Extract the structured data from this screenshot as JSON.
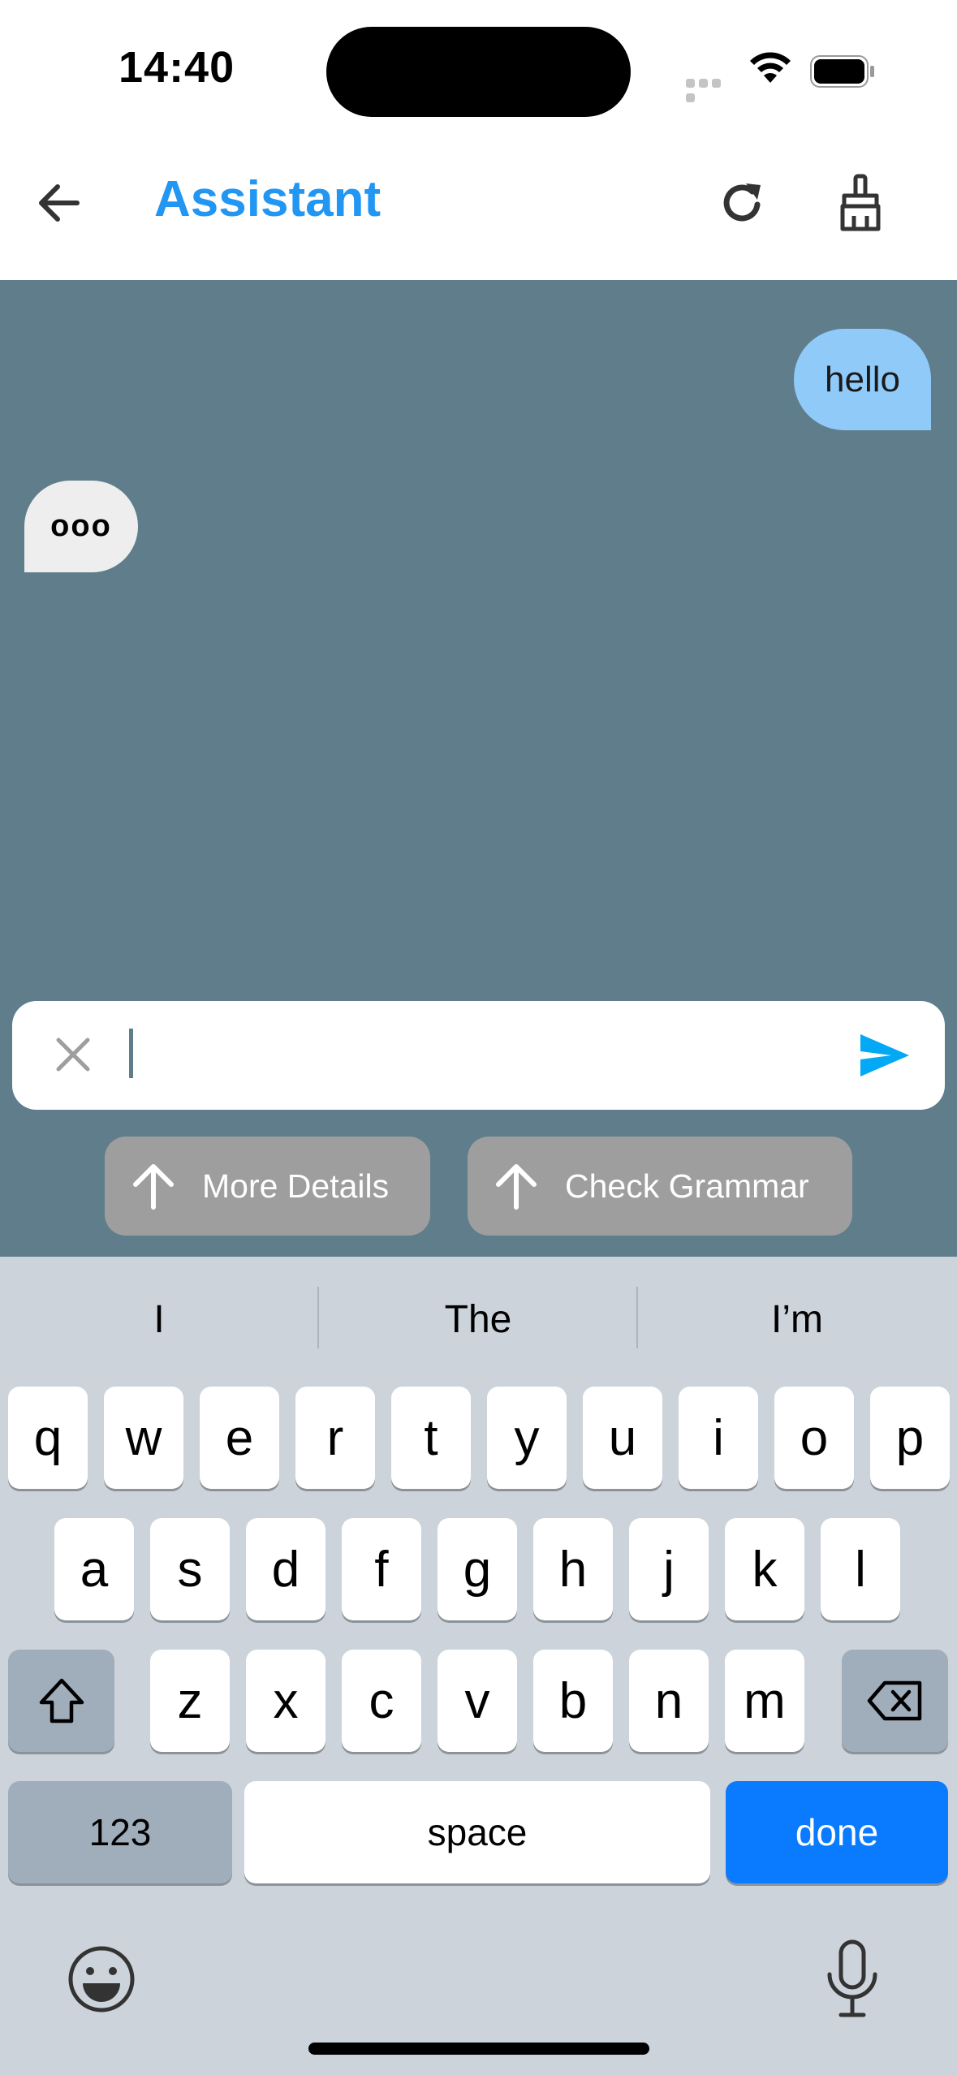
{
  "status_bar": {
    "time": "14:40"
  },
  "app_bar": {
    "title": "Assistant",
    "title_color": "#2196f3"
  },
  "chat": {
    "background": "#607d8b",
    "messages": [
      {
        "role": "user",
        "text": "hello"
      },
      {
        "role": "assistant",
        "text": "ooo"
      }
    ]
  },
  "input": {
    "value": "",
    "placeholder": ""
  },
  "suggestions": [
    {
      "label": "More Details",
      "icon": "arrow-up-icon"
    },
    {
      "label": "Check Grammar",
      "icon": "arrow-up-icon"
    }
  ],
  "keyboard": {
    "predictions": [
      "I",
      "The",
      "I’m"
    ],
    "row1": [
      "q",
      "w",
      "e",
      "r",
      "t",
      "y",
      "u",
      "i",
      "o",
      "p"
    ],
    "row2": [
      "a",
      "s",
      "d",
      "f",
      "g",
      "h",
      "j",
      "k",
      "l"
    ],
    "row3": [
      "z",
      "x",
      "c",
      "v",
      "b",
      "n",
      "m"
    ],
    "numbers_label": "123",
    "space_label": "space",
    "done_label": "done",
    "done_color": "#0a7aff"
  }
}
